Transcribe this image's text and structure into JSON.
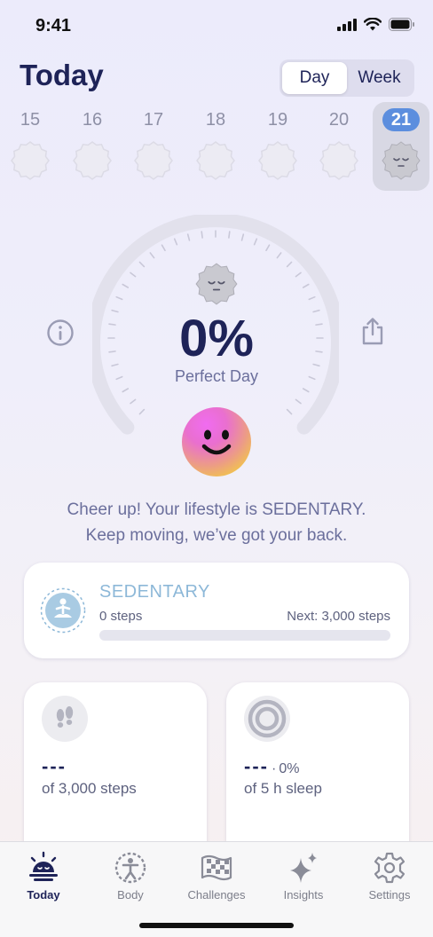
{
  "status_bar": {
    "time": "9:41"
  },
  "header": {
    "title": "Today"
  },
  "segmented": {
    "day": "Day",
    "week": "Week",
    "selected": "Day"
  },
  "dates": [
    {
      "num": "15",
      "selected": false
    },
    {
      "num": "16",
      "selected": false
    },
    {
      "num": "17",
      "selected": false
    },
    {
      "num": "18",
      "selected": false
    },
    {
      "num": "19",
      "selected": false
    },
    {
      "num": "20",
      "selected": false
    },
    {
      "num": "21",
      "selected": true
    }
  ],
  "progress": {
    "percent": "0%",
    "label": "Perfect Day",
    "value": 0
  },
  "message": {
    "line1": "Cheer up! Your lifestyle is SEDENTARY.",
    "line2": "Keep moving, we’ve got your back."
  },
  "level": {
    "name": "SEDENTARY",
    "steps": "0 steps",
    "next": "Next: 3,000 steps",
    "progress": 0,
    "color": "#8DB8D8"
  },
  "steps_card": {
    "value": "---",
    "label": "of 3,000 steps",
    "icon": "footprints-icon"
  },
  "sleep_card": {
    "value": "---",
    "percent": "0%",
    "label": "of 5 h sleep",
    "icon": "ring-icon"
  },
  "tabs": [
    {
      "label": "Today",
      "icon": "today-sun-icon",
      "active": true
    },
    {
      "label": "Body",
      "icon": "body-icon",
      "active": false
    },
    {
      "label": "Challenges",
      "icon": "checkered-flag-icon",
      "active": false
    },
    {
      "label": "Insights",
      "icon": "sparkles-icon",
      "active": false
    },
    {
      "label": "Settings",
      "icon": "gear-icon",
      "active": false
    }
  ],
  "colors": {
    "accent": "#5C8EDE",
    "navy": "#1E2358",
    "level": "#8DB8D8"
  }
}
